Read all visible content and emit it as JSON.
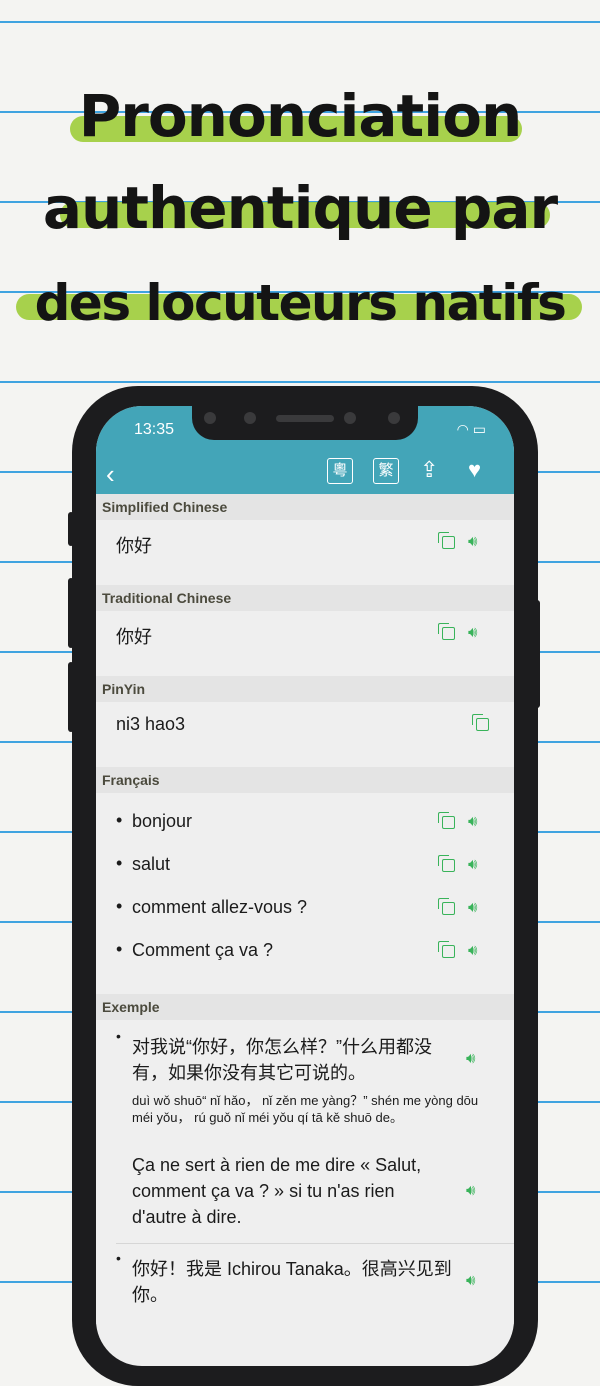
{
  "headline": {
    "line1": "Prononciation",
    "line2": "authentique par",
    "line3": "des locuteurs natifs"
  },
  "status": {
    "time": "13:35",
    "wifi_icon": "wifi-icon",
    "battery_icon": "battery-icon"
  },
  "navbar": {
    "back_icon": "chevron-left-icon",
    "cantonese_label": "粵",
    "traditional_label": "繁",
    "share_icon": "share-icon",
    "favorite_icon": "heart-icon"
  },
  "sections": {
    "simplified": {
      "header": "Simplified Chinese",
      "value": "你好"
    },
    "traditional": {
      "header": "Traditional Chinese",
      "value": "你好"
    },
    "pinyin": {
      "header": "PinYin",
      "value": "ni3 hao3"
    },
    "francais": {
      "header": "Français",
      "items": [
        "bonjour",
        "salut",
        "comment allez-vous ?",
        "Comment ça va ?"
      ]
    },
    "exemple": {
      "header": "Exemple",
      "items": [
        {
          "cn": "对我说“你好，你怎么样？”什么用都没有，如果你没有其它可说的。",
          "pinyin": "duì wǒ shuō“ nǐ hǎo， nǐ zěn me yàng？” shén me yòng dōu méi yǒu， rú guǒ nǐ méi yǒu qí tā kě shuō de。",
          "fr": "Ça ne sert à rien de me dire « Salut, comment ça va ? » si tu n'as rien d'autre à dire."
        },
        {
          "cn": "你好！我是 Ichirou Tanaka。很高兴见到你。"
        }
      ]
    }
  },
  "colors": {
    "accent": "#43a5b8",
    "action": "#39b35a",
    "rule": "#3fa3e0",
    "highlight": "#9fcd3a"
  }
}
